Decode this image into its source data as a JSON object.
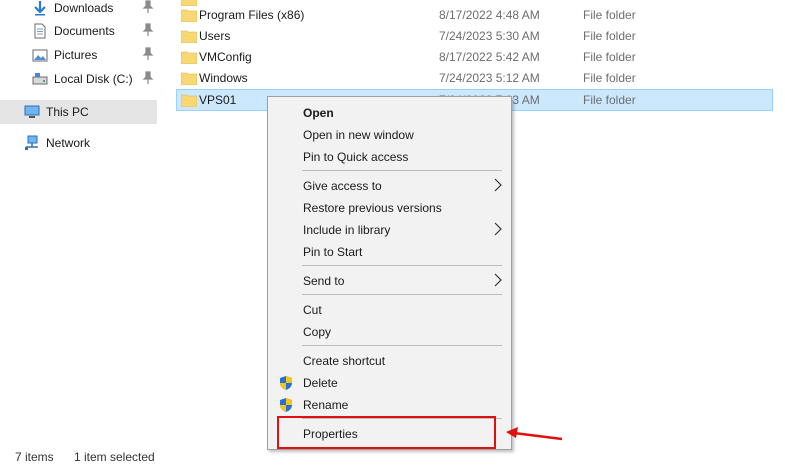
{
  "nav": {
    "items": [
      {
        "label": "Downloads",
        "icon": "download-arrow-icon",
        "pinned": true
      },
      {
        "label": "Documents",
        "icon": "documents-icon",
        "pinned": true
      },
      {
        "label": "Pictures",
        "icon": "pictures-icon",
        "pinned": true
      },
      {
        "label": "Local Disk (C:)",
        "icon": "drive-icon",
        "pinned": true
      },
      {
        "label": "This PC",
        "icon": "computer-icon",
        "selected": true
      },
      {
        "label": "Network",
        "icon": "network-icon"
      }
    ]
  },
  "files": [
    {
      "name": "Program Files (x86)",
      "date": "8/17/2022 4:48 AM",
      "type": "File folder"
    },
    {
      "name": "Users",
      "date": "7/24/2023 5:30 AM",
      "type": "File folder"
    },
    {
      "name": "VMConfig",
      "date": "8/17/2022 5:42 AM",
      "type": "File folder"
    },
    {
      "name": "Windows",
      "date": "7/24/2023 5:12 AM",
      "type": "File folder"
    },
    {
      "name": "VPS01",
      "date": "7/24/2023 7:03 AM",
      "type": "File folder",
      "selected": true
    }
  ],
  "context_menu": {
    "items": [
      {
        "label": "Open",
        "bold": true
      },
      {
        "label": "Open in new window"
      },
      {
        "label": "Pin to Quick access"
      },
      {
        "label": "Give access to",
        "submenu": true
      },
      {
        "label": "Restore previous versions"
      },
      {
        "label": "Include in library",
        "submenu": true
      },
      {
        "label": "Pin to Start"
      },
      {
        "label": "Send to",
        "submenu": true
      },
      {
        "label": "Cut"
      },
      {
        "label": "Copy"
      },
      {
        "label": "Create shortcut"
      },
      {
        "label": "Delete",
        "icon": "uac-shield-icon"
      },
      {
        "label": "Rename",
        "icon": "uac-shield-icon"
      },
      {
        "label": "Properties",
        "highlighted": true
      }
    ]
  },
  "status": {
    "item_count": "7 items",
    "selection": "1 item selected"
  },
  "colors": {
    "selection_bg": "#cce8ff",
    "selection_border": "#99d1ff",
    "folder": "#f8d775",
    "annotation": "#e01010"
  }
}
